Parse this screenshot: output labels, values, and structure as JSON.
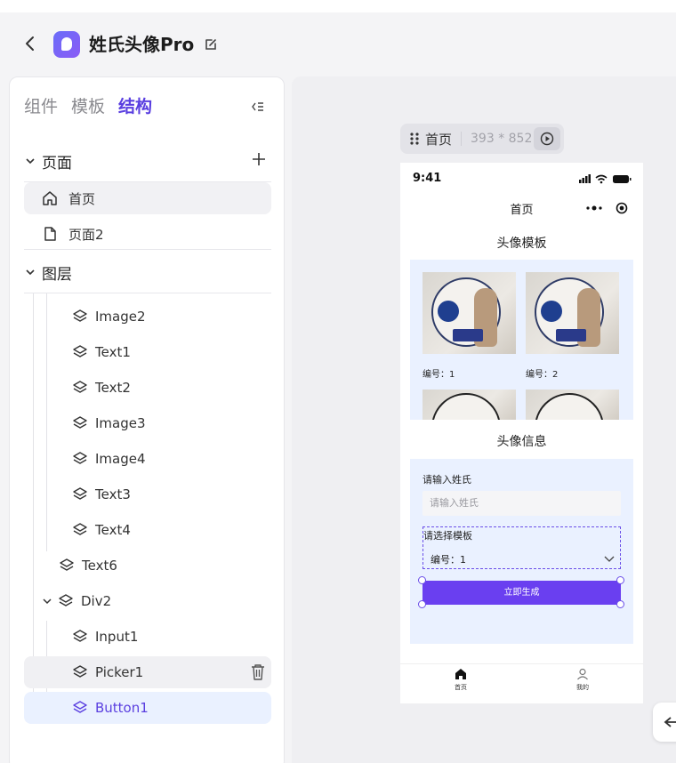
{
  "app": {
    "name": "姓氏头像Pro",
    "brand_color": "#6a5cf5"
  },
  "left_panel": {
    "tabs": [
      {
        "label": "组件",
        "active": false
      },
      {
        "label": "模板",
        "active": false
      },
      {
        "label": "结构",
        "active": true
      }
    ],
    "pages_section": {
      "label": "页面",
      "items": [
        {
          "label": "首页",
          "icon": "home-icon",
          "selected": true
        },
        {
          "label": "页面2",
          "icon": "file-icon",
          "selected": false
        }
      ]
    },
    "layers_section": {
      "label": "图层",
      "items": [
        {
          "label": "Image2",
          "icon": "layers-icon"
        },
        {
          "label": "Text1",
          "icon": "layers-icon"
        },
        {
          "label": "Text2",
          "icon": "layers-icon"
        },
        {
          "label": "Image3",
          "icon": "layers-icon"
        },
        {
          "label": "Image4",
          "icon": "layers-icon"
        },
        {
          "label": "Text3",
          "icon": "layers-icon"
        },
        {
          "label": "Text4",
          "icon": "layers-icon"
        },
        {
          "label": "Text6",
          "icon": "layers-icon"
        },
        {
          "label": "Div2",
          "icon": "layers-icon",
          "expanded": true
        },
        {
          "label": "Input1",
          "icon": "layers-icon"
        },
        {
          "label": "Picker1",
          "icon": "layers-icon",
          "hover": true
        },
        {
          "label": "Button1",
          "icon": "layers-icon",
          "active": true
        }
      ]
    }
  },
  "canvas": {
    "frame_name": "首页",
    "frame_size": "393 * 852"
  },
  "phone": {
    "time": "9:41",
    "nav_title": "首页",
    "template_section_title": "头像模板",
    "templates": [
      {
        "label": "编号：1"
      },
      {
        "label": "编号：2"
      }
    ],
    "info_section_title": "头像信息",
    "surname_label": "请输入姓氏",
    "surname_placeholder": "请输入姓氏",
    "picker_label": "请选择模板",
    "picker_value": "编号：1",
    "generate_button": "立即生成",
    "tabbar": [
      {
        "label": "首页",
        "icon": "home-icon"
      },
      {
        "label": "我的",
        "icon": "user-icon"
      }
    ]
  }
}
